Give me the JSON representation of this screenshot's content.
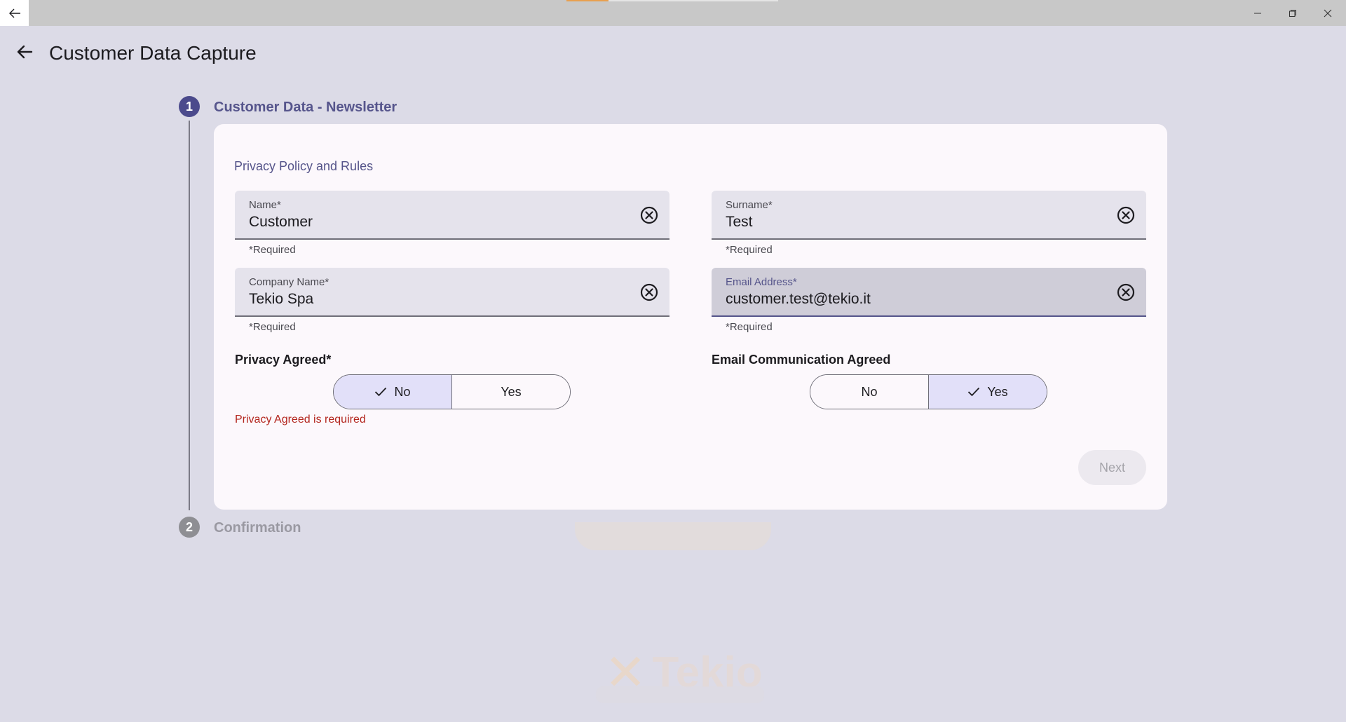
{
  "app": {
    "title": "Customer Data Capture"
  },
  "stepper": {
    "steps": [
      {
        "number": "1",
        "label": "Customer Data - Newsletter"
      },
      {
        "number": "2",
        "label": "Confirmation"
      }
    ]
  },
  "form": {
    "section_title": "Privacy Policy and Rules",
    "fields": {
      "name": {
        "label": "Name*",
        "value": "Customer",
        "helper": "*Required"
      },
      "surname": {
        "label": "Surname*",
        "value": "Test",
        "helper": "*Required"
      },
      "company": {
        "label": "Company Name*",
        "value": "Tekio Spa",
        "helper": "*Required"
      },
      "email": {
        "label": "Email Address*",
        "value": "customer.test@tekio.it",
        "helper": "*Required"
      }
    },
    "privacy": {
      "label": "Privacy Agreed*",
      "options": [
        "No",
        "Yes"
      ],
      "selected": "No",
      "error": "Privacy Agreed is required"
    },
    "email_comm": {
      "label": "Email Communication Agreed",
      "options": [
        "No",
        "Yes"
      ],
      "selected": "Yes"
    },
    "next_label": "Next"
  },
  "colors": {
    "primary": "#55548a",
    "error": "#b3261e",
    "selected_segment": "#e2e0f9",
    "card": "#fcf8fc"
  }
}
